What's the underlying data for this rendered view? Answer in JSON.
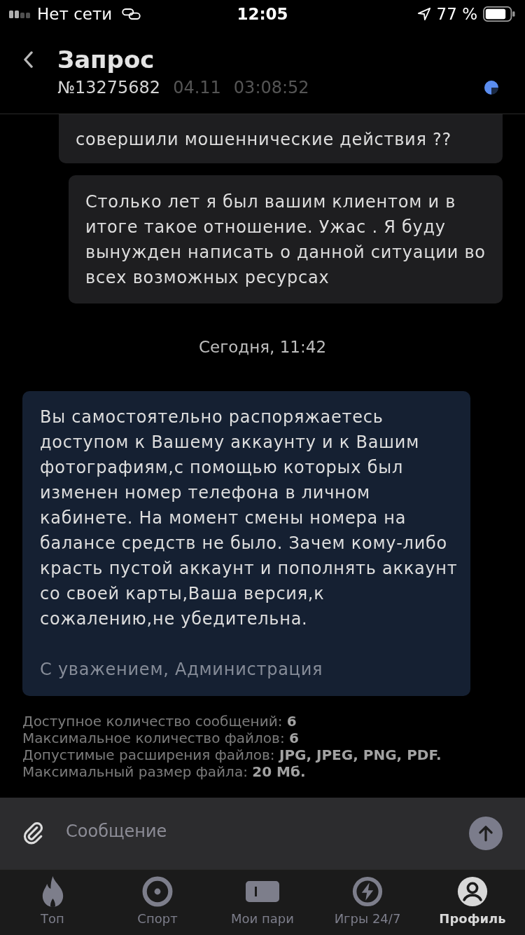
{
  "status_bar": {
    "carrier": "Нет сети",
    "time": "12:05",
    "battery": "77 %"
  },
  "header": {
    "title": "Запрос",
    "number": "№13275682",
    "date": "04.11",
    "time": "03:08:52"
  },
  "messages": [
    {
      "kind": "outgoing",
      "text": "совершили мошеннические действия ??"
    },
    {
      "kind": "outgoing",
      "text": "Столько лет я был вашим клиентом и в итоге такое отношение. Ужас . Я буду вынужден написать о данной ситуации во всех возможных ресурсах"
    },
    {
      "kind": "date",
      "text": "Сегодня, 11:42"
    },
    {
      "kind": "incoming",
      "text": "Вы самостоятельно распоряжаетесь доступом к Вашему аккаунту и к Вашим фотографиям,с помощью которых был изменен номер телефона в личном кабинете. На момент смены номера на балансе средств не было. Зачем кому-либо красть пустой аккаунт и пополнять аккаунт со своей карты,Ваша версия,к сожалению,не убедительна.",
      "signature": "С уважением, Администрация"
    }
  ],
  "limits": [
    "Доступное количество сообщений: **6**",
    "Максимальное количество файлов: **6**",
    "Допустимые расширения файлов: **JPG, JPEG, PNG, PDF.**",
    "Максимальный размер файла: **20 Мб.**"
  ],
  "composer": {
    "placeholder": "Сообщение"
  },
  "tabs": [
    {
      "label": "Топ",
      "selected": false
    },
    {
      "label": "Спорт",
      "selected": false
    },
    {
      "label": "Мои пари",
      "selected": false
    },
    {
      "label": "Игры 24/7",
      "selected": false
    },
    {
      "label": "Профиль",
      "selected": true
    }
  ]
}
